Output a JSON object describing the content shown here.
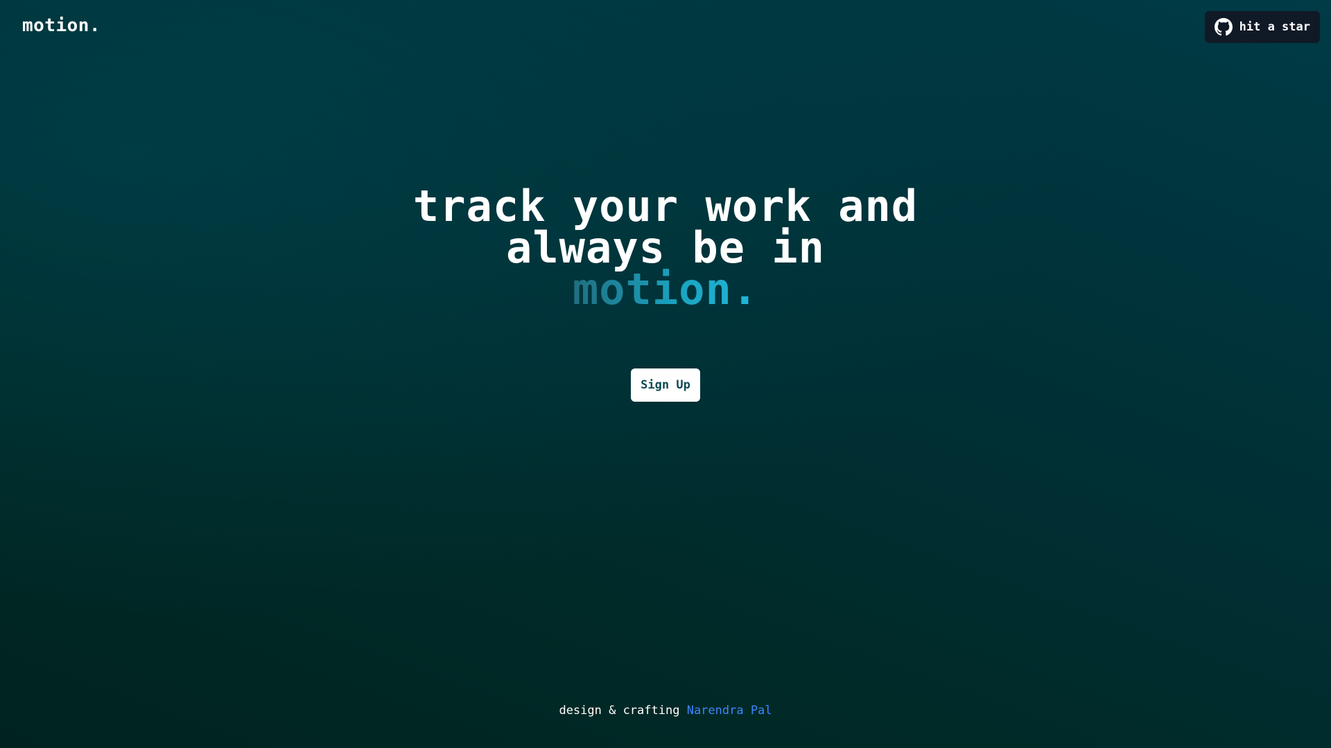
{
  "header": {
    "logo_text": "motion.",
    "github_button": {
      "icon": "github-icon",
      "label": "hit a star"
    }
  },
  "hero": {
    "line1": "track your work and",
    "line2": "always be in",
    "accent": "motion."
  },
  "cta": {
    "signup_label": "Sign Up"
  },
  "footer": {
    "prefix": "design & crafting",
    "author_link": "Narendra Pal"
  },
  "colors": {
    "background_top": "#003b46",
    "background_bottom": "#00231f",
    "accent_start": "#1f6f80",
    "accent_end": "#22b8d8",
    "link": "#3c86ff",
    "star_button_bg": "#101a26",
    "signup_text": "#0d4a54"
  }
}
